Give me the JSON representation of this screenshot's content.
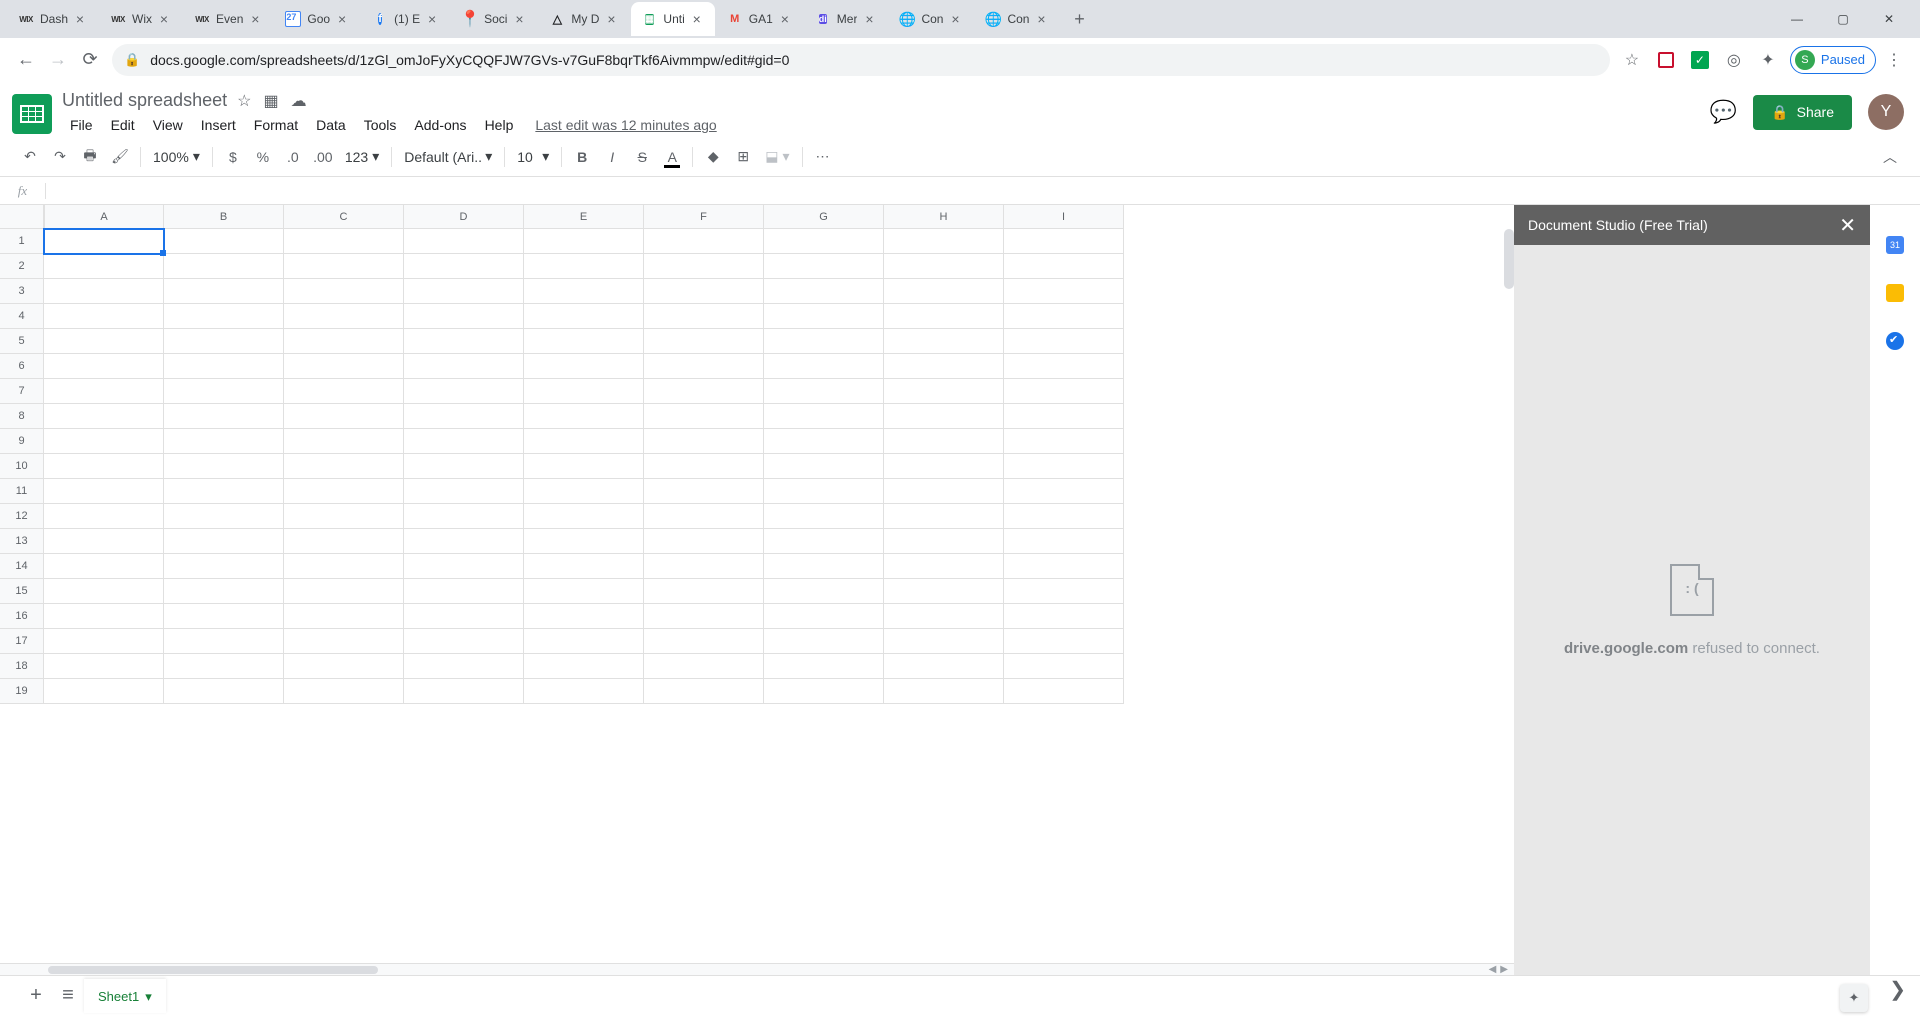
{
  "browser": {
    "tabs": [
      {
        "title": "Dash",
        "fav": "wix"
      },
      {
        "title": "Wix",
        "fav": "wix"
      },
      {
        "title": "Even",
        "fav": "wix"
      },
      {
        "title": "Goo",
        "fav": "cal",
        "badge": "27"
      },
      {
        "title": "(1) E",
        "fav": "fb"
      },
      {
        "title": "Soci",
        "fav": "pin"
      },
      {
        "title": "My D",
        "fav": "drive"
      },
      {
        "title": "Unti",
        "fav": "sheets",
        "active": true
      },
      {
        "title": "GA1",
        "fav": "gmail"
      },
      {
        "title": "Mer",
        "fav": "di"
      },
      {
        "title": "Con",
        "fav": "globe"
      },
      {
        "title": "Con",
        "fav": "globe"
      }
    ],
    "url": "docs.google.com/spreadsheets/d/1zGl_omJoFyXyCQQFJW7GVs-v7GuF8bqrTkf6Aivmmpw/edit#gid=0",
    "profile_letter": "S",
    "profile_status": "Paused"
  },
  "document": {
    "title": "Untitled spreadsheet",
    "last_edit": "Last edit was 12 minutes ago"
  },
  "menus": [
    "File",
    "Edit",
    "View",
    "Insert",
    "Format",
    "Data",
    "Tools",
    "Add-ons",
    "Help"
  ],
  "share_label": "Share",
  "avatar_letter": "Y",
  "toolbar": {
    "zoom": "100%",
    "font": "Default (Ari...",
    "font_size": "10",
    "number_format": "123"
  },
  "columns": [
    "A",
    "B",
    "C",
    "D",
    "E",
    "F",
    "G",
    "H",
    "I"
  ],
  "row_count": 19,
  "selected_cell": "A1",
  "addon": {
    "title": "Document Studio (Free Trial)",
    "error_domain": "drive.google.com",
    "error_rest": " refused to connect."
  },
  "sheet_tab": "Sheet1",
  "rail_cal_badge": "31"
}
